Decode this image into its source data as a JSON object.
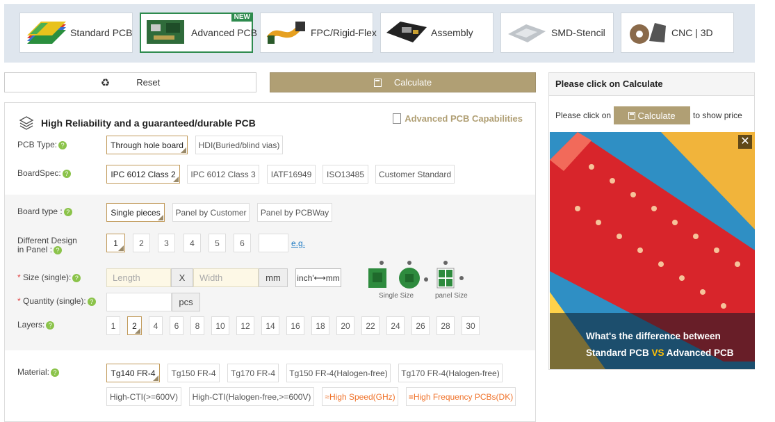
{
  "tabs": [
    {
      "label": "Standard PCB",
      "new": false
    },
    {
      "label": "Advanced PCB",
      "new": true
    },
    {
      "label": "FPC/Rigid-Flex",
      "new": false
    },
    {
      "label": "Assembly",
      "new": false
    },
    {
      "label": "SMD-Stencil",
      "new": false
    },
    {
      "label": "CNC | 3D",
      "new": false
    }
  ],
  "new_badge": "NEW",
  "actions": {
    "reset": "Reset",
    "calculate": "Calculate"
  },
  "form": {
    "title": "High Reliability and a guaranteed/durable PCB",
    "capabilities_link": "Advanced PCB Capabilities",
    "pcb_type": {
      "label": "PCB Type:",
      "options": [
        "Through hole board",
        "HDI(Buried/blind vias)"
      ],
      "selected": "Through hole board"
    },
    "board_spec": {
      "label": "BoardSpec:",
      "options": [
        "IPC 6012 Class 2",
        "IPC 6012 Class 3",
        "IATF16949",
        "ISO13485",
        "Customer Standard"
      ],
      "selected": "IPC 6012 Class 2"
    },
    "board_type": {
      "label": "Board type :",
      "options": [
        "Single pieces",
        "Panel by Customer",
        "Panel by PCBWay"
      ],
      "selected": "Single pieces"
    },
    "diff_design": {
      "label_line1": "Different Design",
      "label_line2": "in Panel :",
      "options": [
        "1",
        "2",
        "3",
        "4",
        "5",
        "6"
      ],
      "selected": "1",
      "eg": "e.g."
    },
    "size": {
      "label": "Size (single):",
      "length_placeholder": "Length",
      "x": "X",
      "width_placeholder": "Width",
      "unit": "mm",
      "toggle": "inch'⟷mm"
    },
    "quantity": {
      "label": "Quantity (single):",
      "unit": "pcs"
    },
    "diagram": {
      "single_caption": "Single Size",
      "panel_caption": "panel Size"
    },
    "layers": {
      "label": "Layers:",
      "options": [
        "1",
        "2",
        "4",
        "6",
        "8",
        "10",
        "12",
        "14",
        "16",
        "18",
        "20",
        "22",
        "24",
        "26",
        "28",
        "30"
      ],
      "selected": "2"
    },
    "material": {
      "label": "Material:",
      "options_row1": [
        "Tg140 FR-4",
        "Tg150 FR-4",
        "Tg170 FR-4",
        "Tg150 FR-4(Halogen-free)",
        "Tg170 FR-4(Halogen-free)"
      ],
      "options_row2": [
        "High-CTI(>=600V)",
        "High-CTI(Halogen-free,>=600V)",
        "≈High Speed(GHz)",
        "≡High Frequency PCBs(DK)"
      ],
      "selected": "Tg140 FR-4"
    },
    "help_glyph": "?"
  },
  "sidebar": {
    "title": "Please click on Calculate",
    "prefix": "Please click on",
    "button": "Calculate",
    "suffix": "to show price",
    "ad_line1": "What's the difference between",
    "ad_line2_a": "Standard PCB ",
    "ad_line2_vs": "VS",
    "ad_line2_b": " Advanced PCB",
    "ad_close": "✕"
  },
  "colors": {
    "accent": "#b09f74",
    "active_tab": "#2e8b4e",
    "orange": "#f0732b",
    "link": "#1a78c2"
  }
}
